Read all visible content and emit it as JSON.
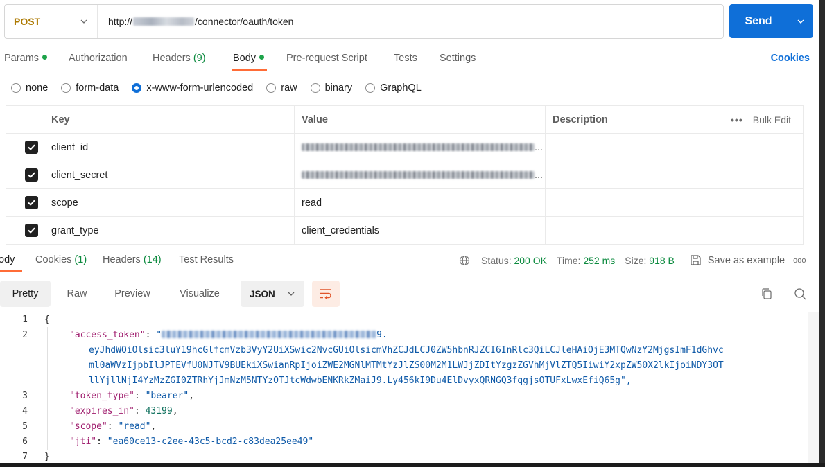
{
  "request": {
    "method": "POST",
    "url_prefix": "http://",
    "url_path": "/connector/oauth/token",
    "send_label": "Send"
  },
  "req_tabs": {
    "params": "Params",
    "authorization": "Authorization",
    "headers": "Headers",
    "headers_count": "(9)",
    "body": "Body",
    "prerequest": "Pre-request Script",
    "tests": "Tests",
    "settings": "Settings",
    "cookies": "Cookies"
  },
  "body_types": [
    "none",
    "form-data",
    "x-www-form-urlencoded",
    "raw",
    "binary",
    "GraphQL"
  ],
  "body_type_selected": "x-www-form-urlencoded",
  "params_table": {
    "headers": {
      "key": "Key",
      "value": "Value",
      "description": "Description",
      "bulk_edit": "Bulk Edit",
      "more": "•••"
    },
    "rows": [
      {
        "key": "client_id",
        "value": "",
        "value_masked": true,
        "value_suffix": "...",
        "checked": true
      },
      {
        "key": "client_secret",
        "value": "",
        "value_masked": true,
        "value_suffix": "...",
        "checked": true
      },
      {
        "key": "scope",
        "value": "read",
        "value_masked": false,
        "value_suffix": "",
        "checked": true
      },
      {
        "key": "grant_type",
        "value": "client_credentials",
        "value_masked": false,
        "value_suffix": "",
        "checked": true
      }
    ]
  },
  "response": {
    "tabs": {
      "body": "ody",
      "cookies": "Cookies",
      "cookies_count": "(1)",
      "headers": "Headers",
      "headers_count": "(14)",
      "test_results": "Test Results"
    },
    "status_label": "Status:",
    "status_value": "200 OK",
    "time_label": "Time:",
    "time_value": "252 ms",
    "size_label": "Size:",
    "size_value": "918 B",
    "save_example": "Save as example",
    "overflow": "ooo"
  },
  "view": {
    "tabs": [
      "Pretty",
      "Raw",
      "Preview",
      "Visualize"
    ],
    "active": "Pretty",
    "format": "JSON"
  },
  "code": {
    "line_numbers": [
      "1",
      "2",
      "3",
      "4",
      "5",
      "6",
      "7"
    ],
    "open_brace": "{",
    "close_brace": "}",
    "access_token_key": "\"access_token\"",
    "access_token_first_tail": "9.",
    "access_token_wrap1": "eyJhdWQiOlsic3luY19hcGlfcmVzb3VyY2UiXSwic2NvcGUiOlsicmVhZCJdLCJ0ZW5hbnRJZCI6InRlc3QiLCJleHAiOjE3MTQwNzY2MjgsImF1dGhvc",
    "access_token_wrap2": "ml0aWVzIjpbIlJPTEVfU0NJTV9BUEkiXSwianRpIjoiZWE2MGNlMTMtYzJlZS00M2M1LWJjZDItYzgzZGVhMjVlZTQ5IiwiY2xpZW50X2lkIjoiNDY3OT",
    "access_token_wrap3": "llYjllNjI4YzMzZGI0ZTRhYjJmNzM5NTYzOTJtcWdwbENKRkZMaiJ9.Ly456kI9Du4ElDvyxQRNGQ3fqgjsOTUFxLwxEfiQ65g\",",
    "token_type_key": "\"token_type\"",
    "token_type_value": "\"bearer\"",
    "expires_in_key": "\"expires_in\"",
    "expires_in_value": "43199",
    "scope_key": "\"scope\"",
    "scope_value": "\"read\"",
    "jti_key": "\"jti\"",
    "jti_value": "\"ea60ce13-c2ee-43c5-bcd2-c83dea25ee49\""
  },
  "colors": {
    "accent": "#ff6c37",
    "primary": "#0f6fd8",
    "success": "#0b8a3e",
    "method_post": "#ad7a03"
  }
}
